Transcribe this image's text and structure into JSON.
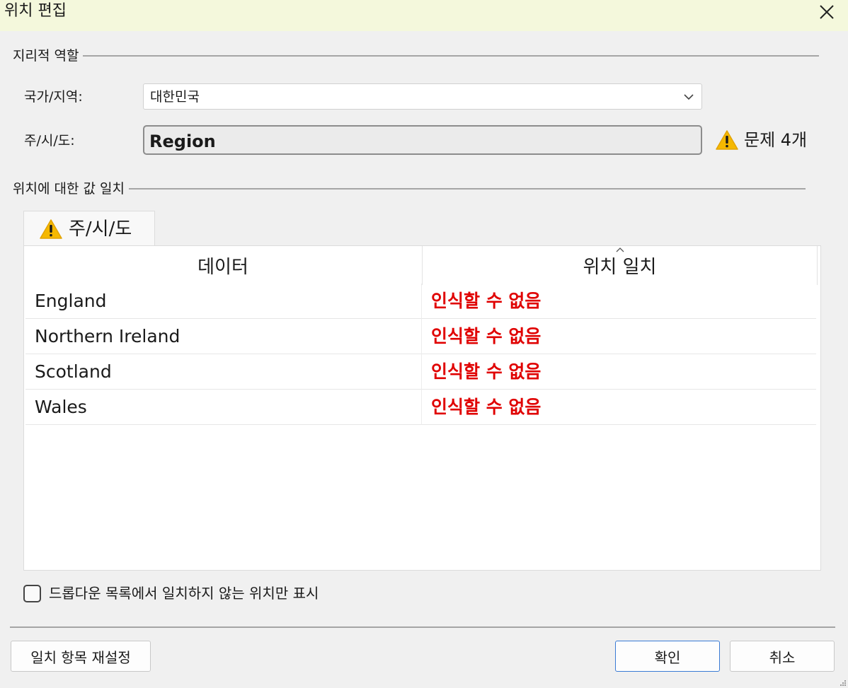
{
  "dialog": {
    "title": "위치 편집",
    "close_icon": "close-icon"
  },
  "geo_section": {
    "header": "지리적 역할",
    "country_label": "국가/지역:",
    "country_value": "대한민국",
    "state_label": "주/시/도:",
    "state_value": "Region",
    "issue_text": "문제 4개",
    "warning_color": "#f5b800"
  },
  "match_section": {
    "header": "위치에 대한 값 일치",
    "tab_label": "주/시/도",
    "columns": [
      "데이터",
      "위치 일치"
    ],
    "rows": [
      {
        "data": "England",
        "status": "인식할 수 없음"
      },
      {
        "data": "Northern Ireland",
        "status": "인식할 수 없음"
      },
      {
        "data": "Scotland",
        "status": "인식할 수 없음"
      },
      {
        "data": "Wales",
        "status": "인식할 수 없음"
      }
    ],
    "status_color": "#e00000",
    "filter_checkbox_label": "드롭다운 목록에서 일치하지 않는 위치만 표시",
    "filter_checked": false
  },
  "footer": {
    "reset_label": "일치 항목 재설정",
    "ok_label": "확인",
    "cancel_label": "취소"
  }
}
